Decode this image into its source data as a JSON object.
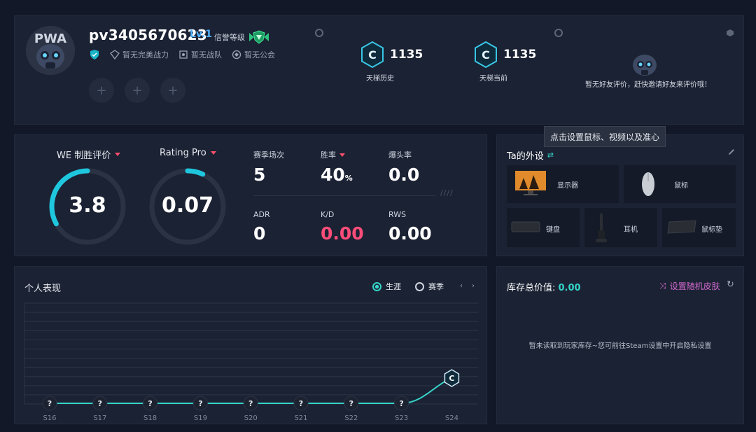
{
  "profile": {
    "username": "pv3405670623",
    "level": "Lv.1",
    "trust_label": "信誉等级",
    "badges": [
      {
        "icon": "diamond-icon",
        "label": "暂无完美战力"
      },
      {
        "icon": "team-icon",
        "label": "暂无战队"
      },
      {
        "icon": "guild-icon",
        "label": "暂无公会"
      }
    ],
    "slot_symbol": "+",
    "ladder": [
      {
        "value": "1135",
        "label": "天梯历史"
      },
      {
        "value": "1135",
        "label": "天梯当前"
      }
    ],
    "friend_eval": "暂无好友评价，赶快邀请好友来评价哦！",
    "avatar_text": "PWA"
  },
  "stats": {
    "we_label": "WE 制胜评价",
    "we_value": "3.8",
    "we_progress": 0.33,
    "rating_label": "Rating Pro",
    "rating_value": "0.07",
    "rating_progress": 0.07,
    "grid": [
      {
        "label": "赛季场次",
        "value": "5",
        "color": "white"
      },
      {
        "label": "胜率",
        "value": "40",
        "unit": "%",
        "color": "white",
        "dropdown": true
      },
      {
        "label": "爆头率",
        "value": "0.0",
        "color": "white"
      },
      {
        "label": "ADR",
        "value": "0",
        "color": "white"
      },
      {
        "label": "K/D",
        "value": "0.00",
        "color": "red"
      },
      {
        "label": "RWS",
        "value": "0.00",
        "color": "white"
      }
    ],
    "hatch": "////"
  },
  "gear": {
    "title": "Ta的外设",
    "tooltip": "点击设置鼠标、视频以及准心",
    "items": {
      "monitor": "显示器",
      "mouse": "鼠标",
      "keyboard": "键盘",
      "headset": "耳机",
      "mousepad": "鼠标垫"
    }
  },
  "performance": {
    "title": "个人表现",
    "radio_career": "生涯",
    "radio_season": "赛季",
    "seasons": [
      "S16",
      "S17",
      "S18",
      "S19",
      "S20",
      "S21",
      "S22",
      "S23",
      "S24"
    ],
    "unknown_mark": "?",
    "rank_mark": "C"
  },
  "inventory": {
    "title": "库存总价值: ",
    "value": "0.00",
    "random_skin": "设置随机皮肤",
    "note": "暂未读取到玩家库存~您可前往Steam设置中开启隐私设置"
  },
  "colors": {
    "accent": "#35d3c8",
    "red": "#ff4d7a",
    "purple": "#d36ad0",
    "panel": "#1b2233"
  }
}
